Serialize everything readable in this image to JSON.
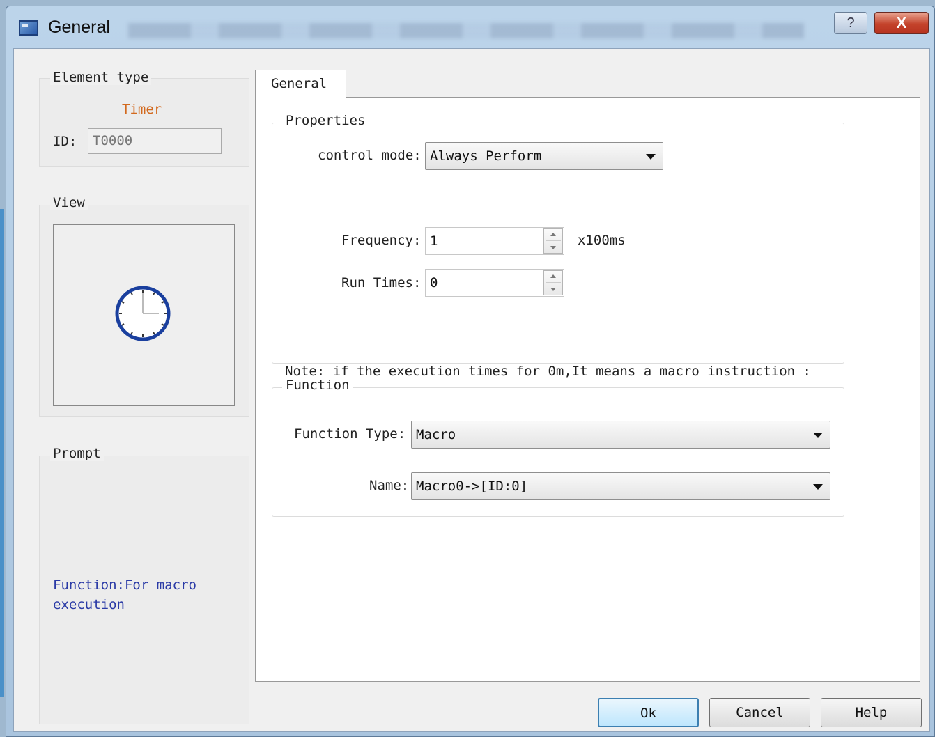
{
  "window": {
    "title": "General",
    "help_glyph": "?",
    "close_glyph": "X"
  },
  "left": {
    "element_type": {
      "legend": "Element type",
      "value": "Timer",
      "value_color": "#d2691e"
    },
    "id": {
      "label": "ID:",
      "value": "T0000"
    },
    "view": {
      "legend": "View",
      "icon": "clock-icon"
    },
    "prompt": {
      "legend": "Prompt",
      "text": "Function:For macro execution",
      "text_color": "#2a3aa6"
    }
  },
  "tabs": [
    {
      "label": "General",
      "active": true
    }
  ],
  "properties": {
    "legend": "Properties",
    "control_mode": {
      "label": "control mode:",
      "value": "Always Perform"
    },
    "frequency": {
      "label": "Frequency:",
      "value": "1",
      "unit": "x100ms"
    },
    "run_times": {
      "label": "Run Times:",
      "value": "0"
    },
    "note": "Note: if the execution times for 0m,It means a macro instruction :"
  },
  "function": {
    "legend": "Function",
    "function_type": {
      "label": "Function Type:",
      "value": "Macro"
    },
    "name": {
      "label": "Name:",
      "value": "Macro0->[ID:0]"
    }
  },
  "buttons": {
    "ok": "Ok",
    "cancel": "Cancel",
    "help": "Help"
  }
}
